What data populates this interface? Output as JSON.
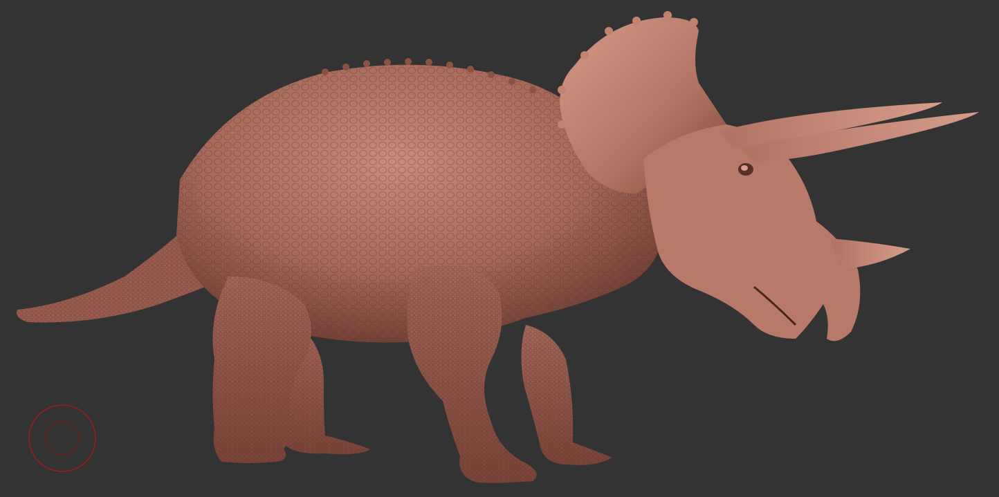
{
  "viewport": {
    "background_color": "#333333",
    "model": {
      "subject": "triceratops-sculpt",
      "material_color": "#b5786a",
      "material_highlight": "#d79c8a",
      "material_shadow": "#5a2e26"
    },
    "brush_cursor": {
      "icon": "brush-cursor-icon",
      "color": "#9c1c1c"
    }
  }
}
